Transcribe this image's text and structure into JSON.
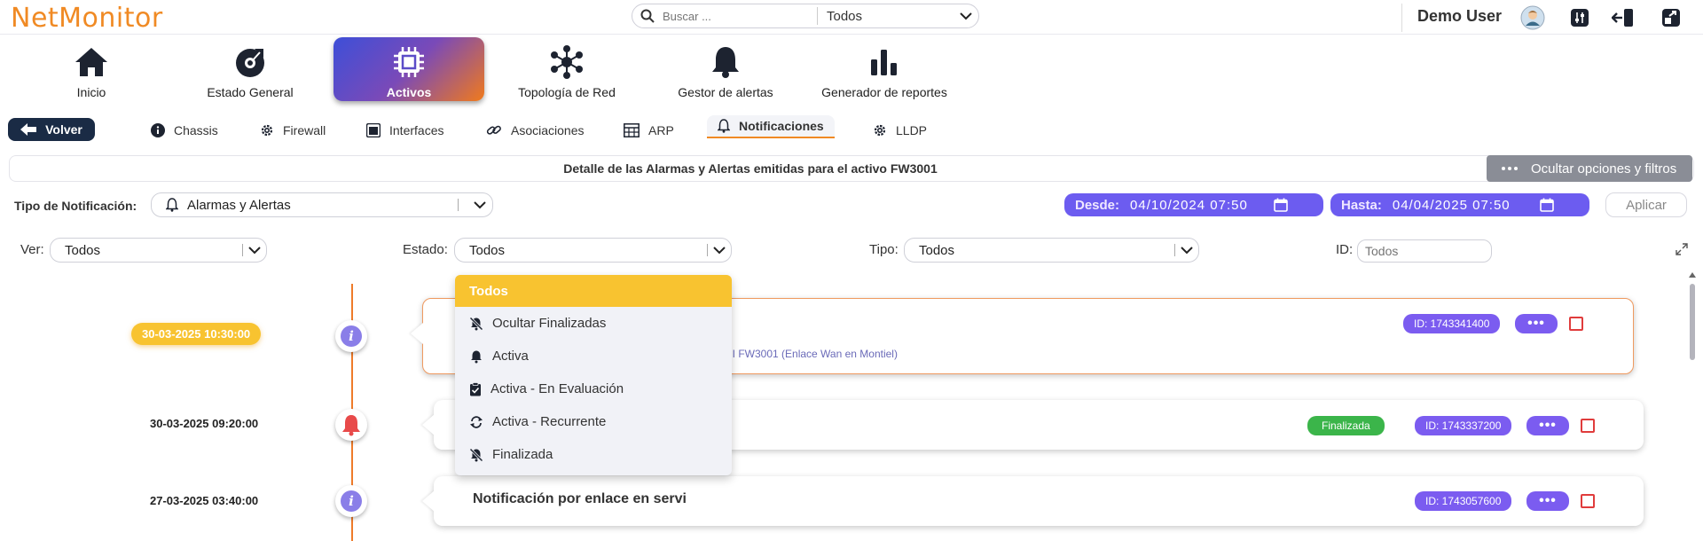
{
  "app": {
    "logo": "NetMonitor"
  },
  "search": {
    "placeholder": "Buscar ...",
    "scope": "Todos"
  },
  "user": {
    "name": "Demo User"
  },
  "nav": [
    {
      "label": "Inicio",
      "icon": "home-icon"
    },
    {
      "label": "Estado General",
      "icon": "dashboard-icon"
    },
    {
      "label": "Activos",
      "icon": "chip-icon",
      "active": true
    },
    {
      "label": "Topología de Red",
      "icon": "network-icon"
    },
    {
      "label": "Gestor de alertas",
      "icon": "bell-icon"
    },
    {
      "label": "Generador de reportes",
      "icon": "chart-icon"
    }
  ],
  "subnav": {
    "back": "Volver",
    "tabs": [
      "Chassis",
      "Firewall",
      "Interfaces",
      "Asociaciones",
      "ARP",
      "Notificaciones",
      "LLDP"
    ],
    "active": "Notificaciones"
  },
  "detail": {
    "title": "Detalle de las Alarmas y Alertas emitidas para el activo FW3001",
    "hide_button": "Ocultar opciones y filtros"
  },
  "filters": {
    "tipo_label": "Tipo de Notificación:",
    "tipo_value": "Alarmas y Alertas",
    "desde_label": "Desde:",
    "desde_value": "04/10/2024 07:50",
    "hasta_label": "Hasta:",
    "hasta_value": "04/04/2025 07:50",
    "apply": "Aplicar",
    "ver_label": "Ver:",
    "ver_value": "Todos",
    "estado_label": "Estado:",
    "estado_value": "Todos",
    "tipo2_label": "Tipo:",
    "tipo2_value": "Todos",
    "id_label": "ID:",
    "id_placeholder": "Todos"
  },
  "estado_dropdown": [
    "Todos",
    "Ocultar Finalizadas",
    "Activa",
    "Activa - En Evaluación",
    "Activa - Recurrente",
    "Finalizada"
  ],
  "timeline": [
    {
      "date": "30-03-2025 10:30:00",
      "id": "ID: 1743341400",
      "sub": "NI FW3001 (Enlace Wan en Montiel)",
      "type": "info"
    },
    {
      "date": "30-03-2025 09:20:00",
      "id": "ID: 1743337200",
      "status": "Finalizada",
      "type": "alarm"
    },
    {
      "date": "27-03-2025 03:40:00",
      "id": "ID: 1743057600",
      "text": "Notificación por enlace en servi",
      "type": "info"
    }
  ],
  "colors": {
    "accent_orange": "#f08a24",
    "purple": "#7b5cf0",
    "yellow": "#f8c330",
    "green": "#3bb54a",
    "red": "#e03c3c"
  }
}
